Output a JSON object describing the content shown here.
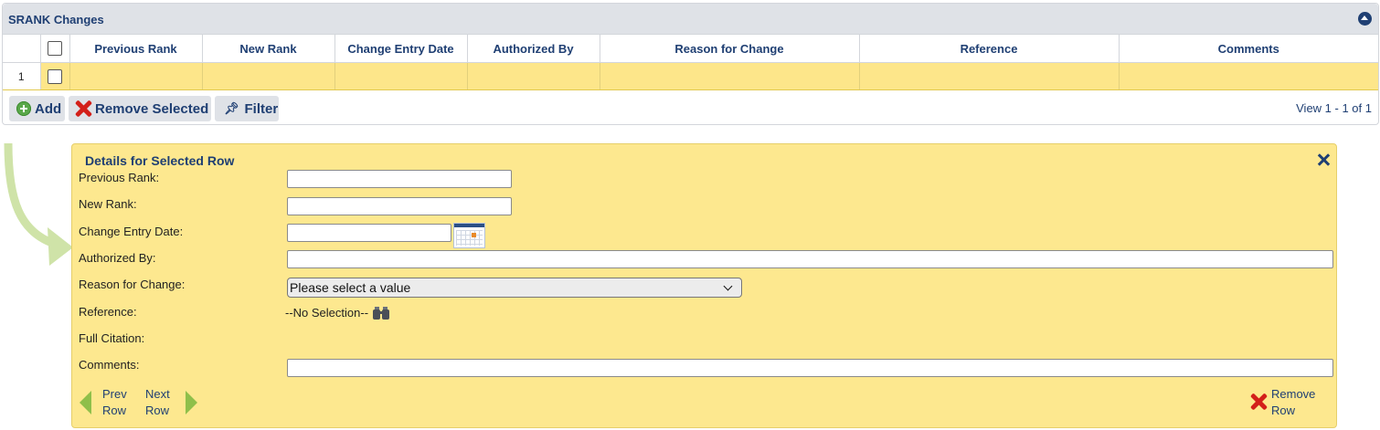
{
  "grid": {
    "title": "SRANK Changes",
    "columns": [
      "Previous Rank",
      "New Rank",
      "Change Entry Date",
      "Authorized By",
      "Reason for Change",
      "Reference",
      "Comments"
    ],
    "rows": [
      {
        "num": "1",
        "cells": [
          "",
          "",
          "",
          "",
          "",
          "",
          ""
        ]
      }
    ],
    "pager": {
      "add_label": "Add",
      "remove_label": "Remove Selected",
      "filter_label": "Filter",
      "view_info": "View 1 - 1 of 1"
    }
  },
  "details": {
    "title": "Details for Selected Row",
    "fields": {
      "previous_rank": {
        "label": "Previous Rank:",
        "value": ""
      },
      "new_rank": {
        "label": "New Rank:",
        "value": ""
      },
      "change_entry_date": {
        "label": "Change Entry Date:",
        "value": ""
      },
      "authorized_by": {
        "label": "Authorized By:",
        "value": ""
      },
      "reason_for_change": {
        "label": "Reason for Change:",
        "selected": "Please select a value"
      },
      "reference": {
        "label": "Reference:",
        "value": "--No Selection--"
      },
      "full_citation": {
        "label": "Full Citation:",
        "value": ""
      },
      "comments": {
        "label": "Comments:",
        "value": ""
      }
    },
    "nav": {
      "prev_line1": "Prev",
      "prev_line2": "Row",
      "next_line1": "Next",
      "next_line2": "Row",
      "remove_line1": "Remove",
      "remove_line2": "Row"
    }
  },
  "colors": {
    "header_text": "#1f3f73",
    "row_highlight": "#fde68a",
    "details_bg": "#fde88f",
    "arrow_green": "#cfe3a8",
    "nav_green": "#8fbf4a",
    "remove_red": "#d3201a"
  }
}
